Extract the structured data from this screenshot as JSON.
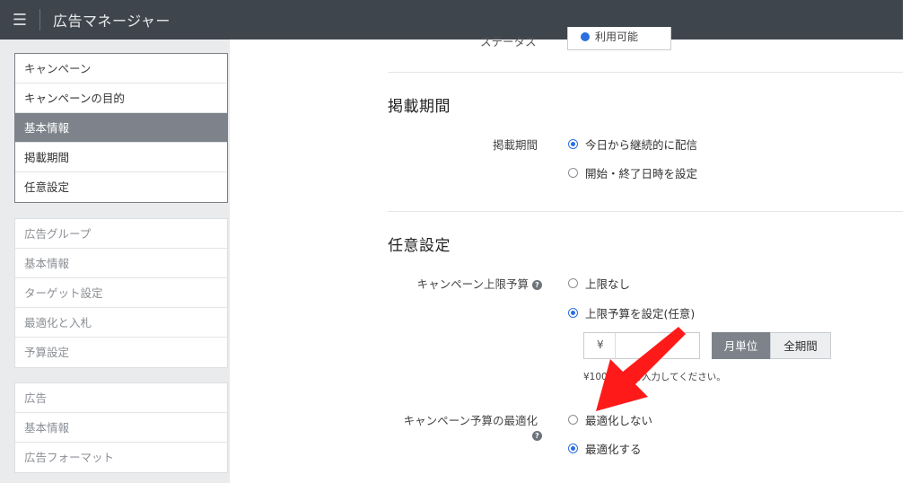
{
  "header": {
    "menu_icon": "menu-icon",
    "title": "広告マネージャー"
  },
  "sidebar": {
    "campaign": {
      "header": "キャンペーン",
      "items": [
        "キャンペーンの目的",
        "基本情報",
        "掲載期間",
        "任意設定"
      ],
      "selected_index": 1
    },
    "ad_group": {
      "header": "広告グループ",
      "items": [
        "基本情報",
        "ターゲット設定",
        "最適化と入札",
        "予算設定"
      ]
    },
    "ad": {
      "header": "広告",
      "items": [
        "基本情報",
        "広告フォーマット"
      ]
    }
  },
  "main": {
    "status": {
      "label": "ステータス",
      "value": "利用可能"
    },
    "period": {
      "title": "掲載期間",
      "label": "掲載期間",
      "options": [
        "今日から継続的に配信",
        "開始・終了日時を設定"
      ],
      "selected_index": 0
    },
    "optional": {
      "title": "任意設定",
      "budget_label": "キャンペーン上限予算",
      "budget_options": [
        "上限なし",
        "上限予算を設定(任意)"
      ],
      "budget_selected_index": 1,
      "currency": "¥",
      "amount": "",
      "segments": [
        "月単位",
        "全期間"
      ],
      "segment_selected_index": 0,
      "hint": "¥1000以上を入力してください。",
      "optimize_label": "キャンペーン予算の最適化",
      "optimize_options": [
        "最適化しない",
        "最適化する"
      ],
      "optimize_selected_index": 1
    }
  },
  "annotation": {
    "arrow_color": "#ff1a1a"
  }
}
